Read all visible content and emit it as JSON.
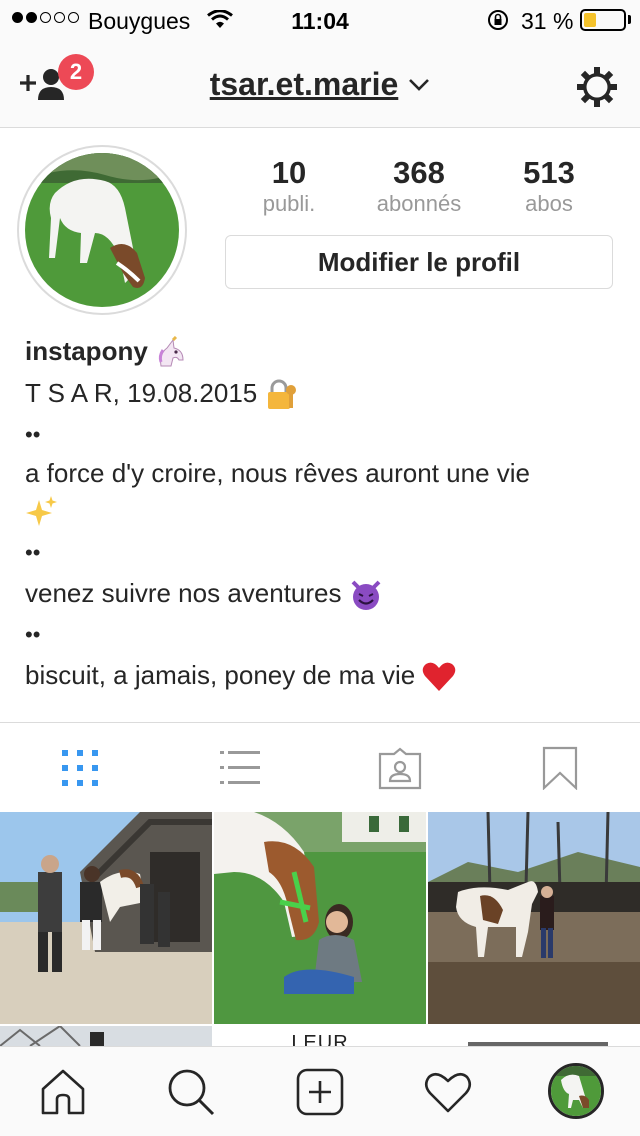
{
  "status_bar": {
    "carrier": "Bouygues",
    "time": "11:04",
    "battery_percent": "31 %",
    "battery_level": 0.31,
    "signal_bars_filled": 2,
    "signal_bars_total": 5
  },
  "header": {
    "username": "tsar.et.marie",
    "notification_count": "2",
    "icons": [
      "add-user-icon",
      "chevron-down-icon",
      "settings-gear-icon"
    ]
  },
  "profile": {
    "stats": [
      {
        "value": "10",
        "label": "publi."
      },
      {
        "value": "368",
        "label": "abonnés"
      },
      {
        "value": "513",
        "label": "abos"
      }
    ],
    "edit_button": "Modifier le profil",
    "bio": {
      "name": "instapony",
      "line1": "T S A R, 19.08.2015",
      "dots": "••",
      "line2": "a force d'y croire, nous rêves auront une vie",
      "line3": "venez suivre nos aventures",
      "line4": "biscuit, a jamais, poney de ma vie"
    }
  },
  "tabs": {
    "active": "grid",
    "items": [
      "grid-view-icon",
      "list-view-icon",
      "tagged-photos-icon",
      "saved-bookmark-icon"
    ],
    "active_color": "#3897f0"
  },
  "grid": {
    "partial_row_text": "LEUR"
  },
  "bottom_nav": {
    "items": [
      "home-icon",
      "search-icon",
      "new-post-icon",
      "activity-heart-icon",
      "profile-avatar"
    ]
  }
}
